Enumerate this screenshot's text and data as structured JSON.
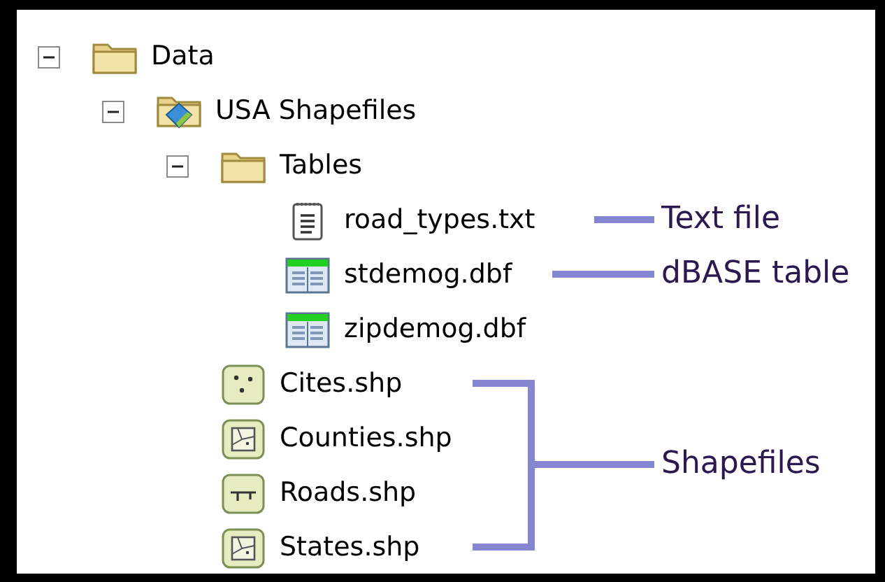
{
  "tree": [
    {
      "label": "Data",
      "kind": "folder",
      "expanded": true,
      "children": [
        {
          "label": "USA Shapefiles",
          "kind": "gis_folder",
          "expanded": true,
          "children": [
            {
              "label": "Tables",
              "kind": "folder",
              "expanded": true,
              "children": [
                {
                  "label": "road_types.txt",
                  "kind": "text"
                },
                {
                  "label": "stdemog.dbf",
                  "kind": "table"
                },
                {
                  "label": "zipdemog.dbf",
                  "kind": "table"
                }
              ]
            },
            {
              "label": "Cites.shp",
              "kind": "point"
            },
            {
              "label": "Counties.shp",
              "kind": "polygon"
            },
            {
              "label": "Roads.shp",
              "kind": "line"
            },
            {
              "label": "States.shp",
              "kind": "polygon"
            }
          ]
        }
      ]
    }
  ],
  "annotations": [
    {
      "label": "Text file"
    },
    {
      "label": "dBASE table"
    },
    {
      "label": "Shapefiles"
    }
  ]
}
